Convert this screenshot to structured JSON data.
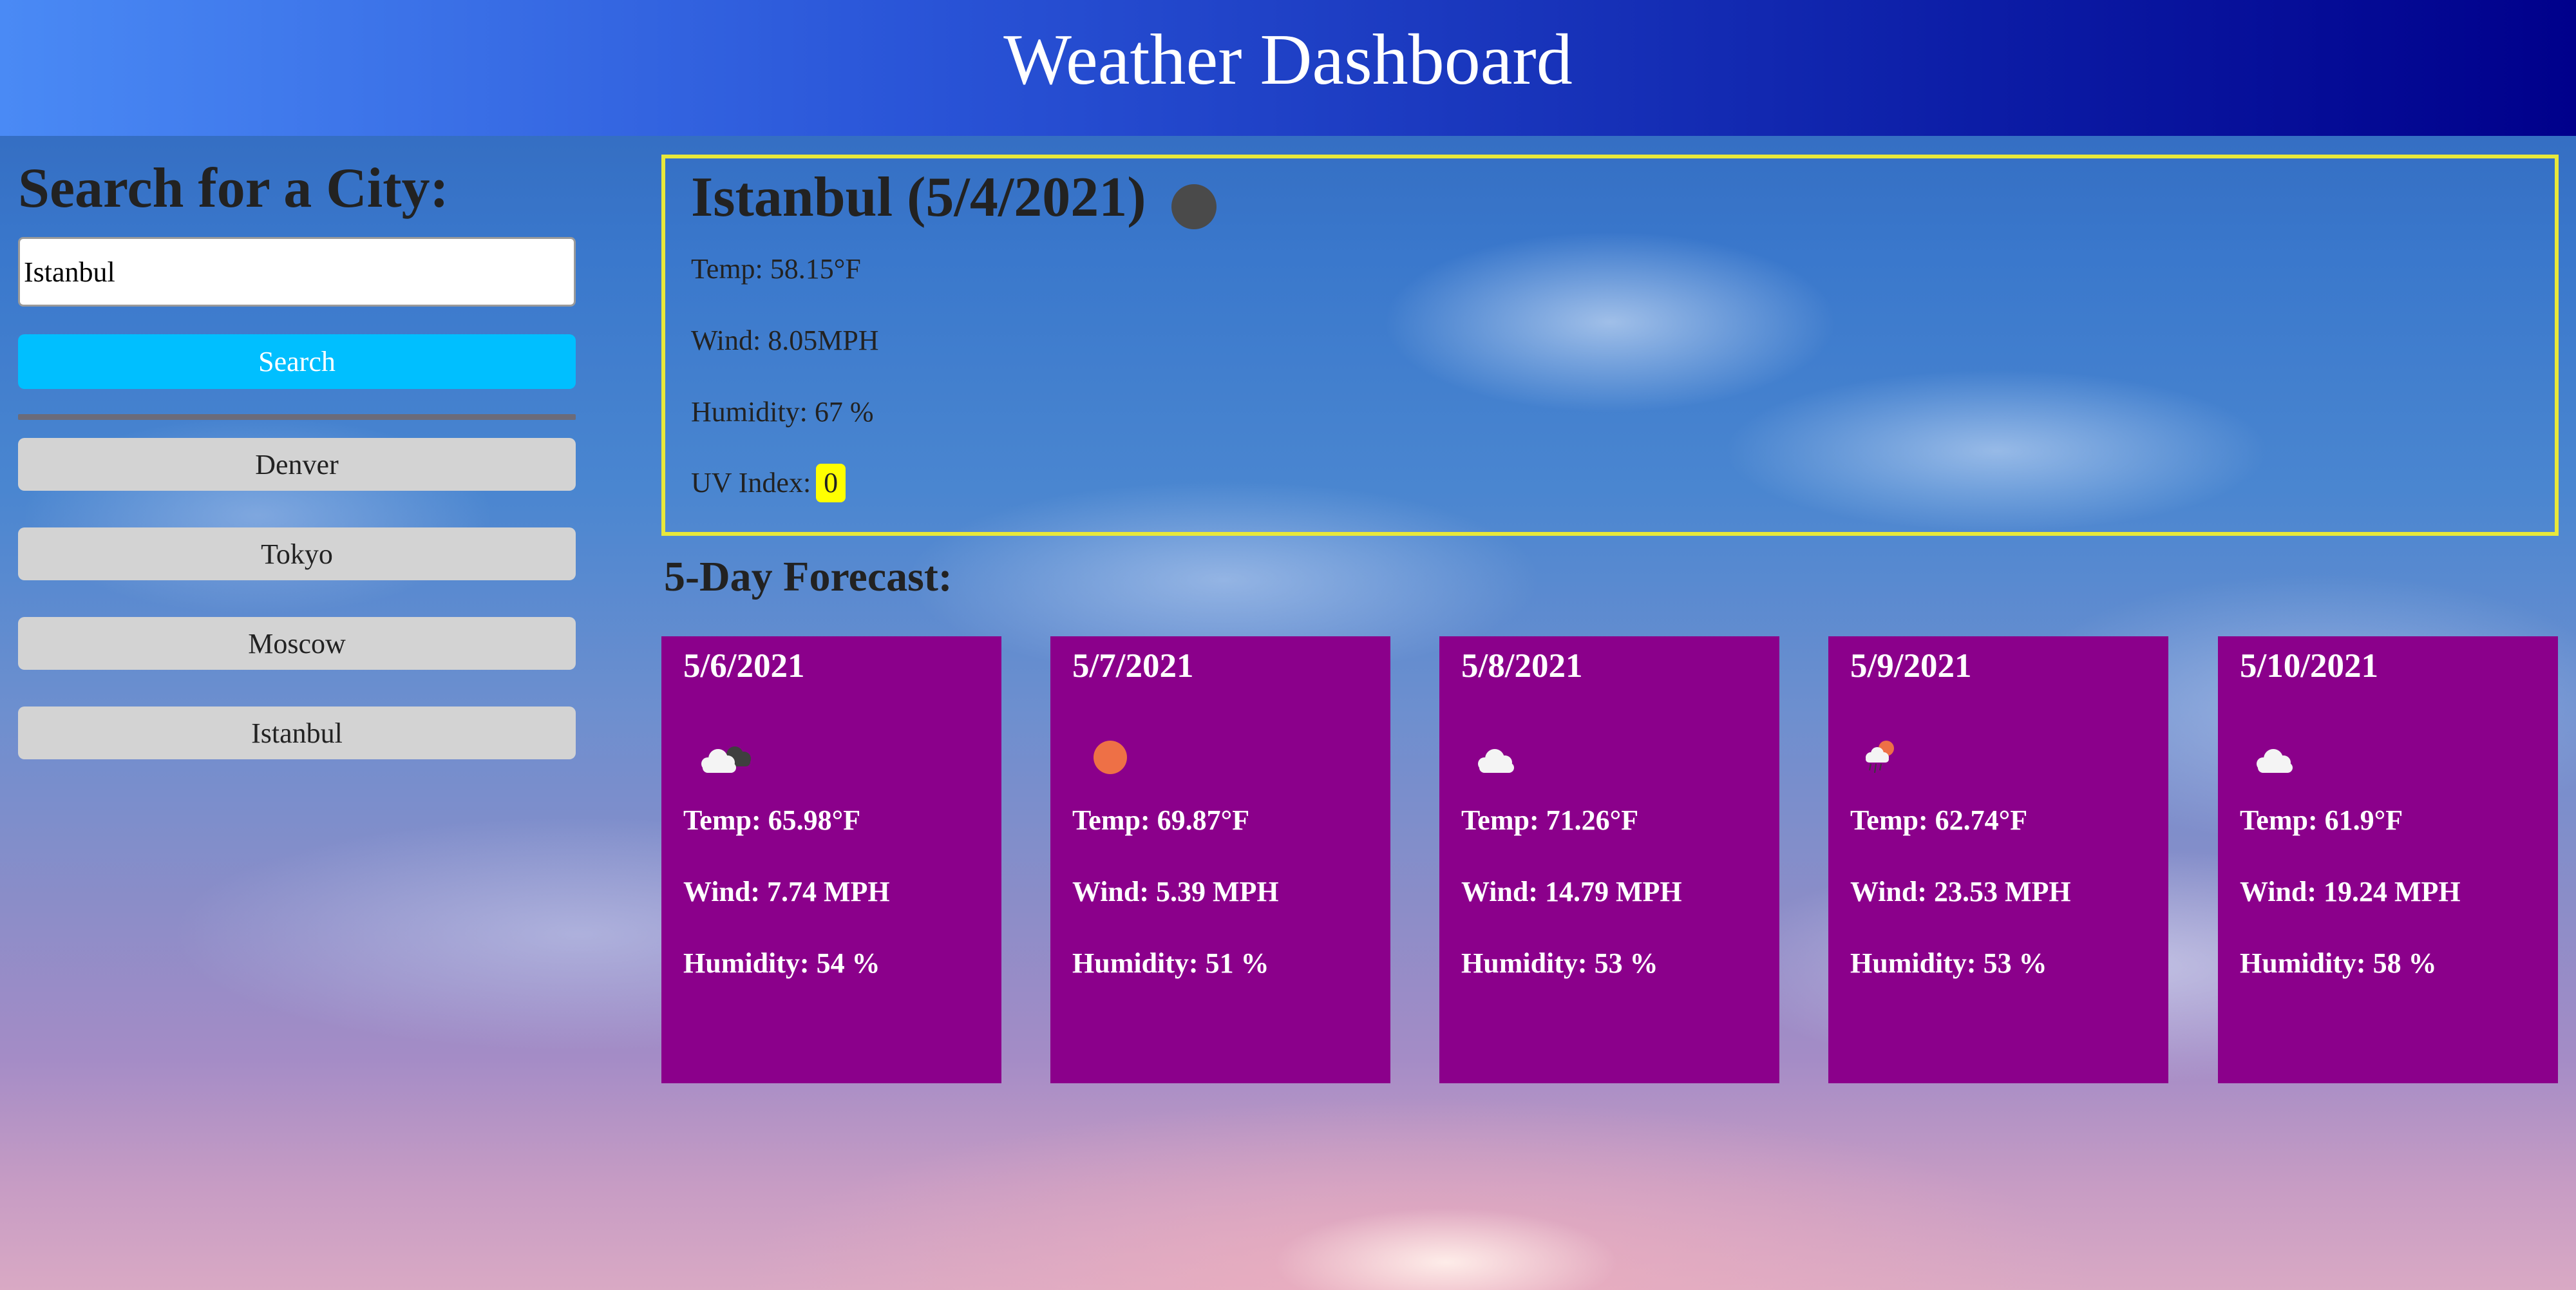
{
  "header": {
    "title": "Weather Dashboard"
  },
  "sidebar": {
    "heading": "Search for a City:",
    "search_value": "Istanbul",
    "search_button": "Search",
    "history": [
      "Denver",
      "Tokyo",
      "Moscow",
      "Istanbul"
    ]
  },
  "current": {
    "title": "Istanbul (5/4/2021)",
    "icon": "dark-circle-icon",
    "temp": "Temp: 58.15°F",
    "wind": "Wind: 8.05MPH",
    "humidity": "Humidity: 67 %",
    "uv_label": "UV Index:",
    "uv_value": "0"
  },
  "forecast": {
    "heading": "5-Day Forecast:",
    "days": [
      {
        "date": "5/6/2021",
        "icon": "cloud-with-dark-cloud-icon",
        "temp": "Temp: 65.98°F",
        "wind": "Wind: 7.74 MPH",
        "humidity": "Humidity: 54 %"
      },
      {
        "date": "5/7/2021",
        "icon": "sun-icon",
        "temp": "Temp: 69.87°F",
        "wind": "Wind: 5.39 MPH",
        "humidity": "Humidity: 51 %"
      },
      {
        "date": "5/8/2021",
        "icon": "cloud-icon",
        "temp": "Temp: 71.26°F",
        "wind": "Wind: 14.79 MPH",
        "humidity": "Humidity: 53 %"
      },
      {
        "date": "5/9/2021",
        "icon": "sun-rain-cloud-icon",
        "temp": "Temp: 62.74°F",
        "wind": "Wind: 23.53 MPH",
        "humidity": "Humidity: 53 %"
      },
      {
        "date": "5/10/2021",
        "icon": "cloud-icon",
        "temp": "Temp: 61.9°F",
        "wind": "Wind: 19.24 MPH",
        "humidity": "Humidity: 58 %"
      }
    ]
  },
  "colors": {
    "header_start": "#4a8af5",
    "header_end": "#00008b",
    "search_button": "#00bfff",
    "history_button": "#d3d3d3",
    "forecast_card": "#8b008b",
    "current_border": "#e8e83a",
    "uv_badge": "#ffff00"
  }
}
